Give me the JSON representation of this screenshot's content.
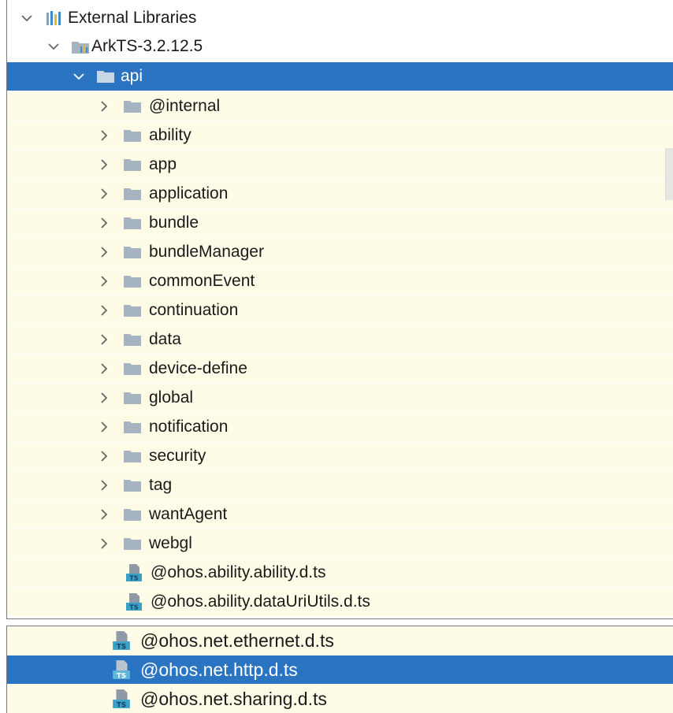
{
  "colors": {
    "selection": "#2a74c2",
    "tree_background": "#fefce7",
    "folder_icon": "#a6b4c2",
    "ts_badge": "#3ba0c6",
    "library_icon": "#3a8ed0"
  },
  "tree": {
    "root": {
      "label": "External Libraries",
      "icon": "library-icon",
      "expanded": true
    },
    "sdk": {
      "label": "ArkTS-3.2.12.5",
      "icon": "sdk-library-icon",
      "expanded": true
    },
    "api": {
      "label": "api",
      "icon": "folder-icon",
      "expanded": true,
      "selected": true
    },
    "folders": [
      {
        "label": "@internal"
      },
      {
        "label": "ability"
      },
      {
        "label": "app"
      },
      {
        "label": "application"
      },
      {
        "label": "bundle"
      },
      {
        "label": "bundleManager"
      },
      {
        "label": "commonEvent"
      },
      {
        "label": "continuation"
      },
      {
        "label": "data"
      },
      {
        "label": "device-define"
      },
      {
        "label": "global"
      },
      {
        "label": "notification"
      },
      {
        "label": "security"
      },
      {
        "label": "tag"
      },
      {
        "label": "wantAgent"
      },
      {
        "label": "webgl"
      }
    ],
    "files": [
      {
        "label": "@ohos.ability.ability.d.ts",
        "icon": "ts-file-icon"
      },
      {
        "label": "@ohos.ability.dataUriUtils.d.ts",
        "icon": "ts-file-icon"
      }
    ]
  },
  "second_panel": {
    "files": [
      {
        "label": "@ohos.net.ethernet.d.ts",
        "icon": "ts-file-icon",
        "selected": false
      },
      {
        "label": "@ohos.net.http.d.ts",
        "icon": "ts-file-icon",
        "selected": true
      },
      {
        "label": "@ohos.net.sharing.d.ts",
        "icon": "ts-file-icon",
        "selected": false
      }
    ]
  }
}
